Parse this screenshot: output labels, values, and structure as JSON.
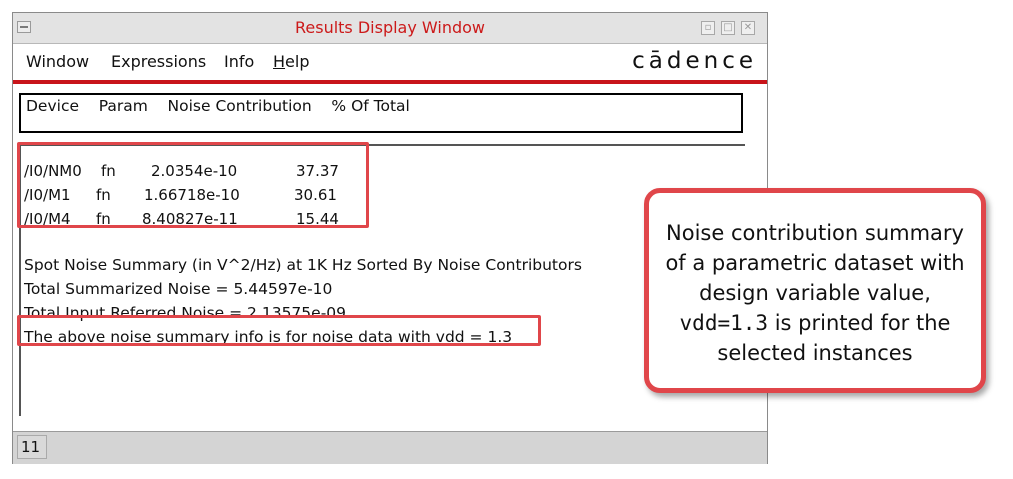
{
  "window": {
    "title": "Results Display Window",
    "controls": [
      "▫",
      "□",
      "✕"
    ]
  },
  "menu": {
    "items": [
      {
        "label": "Window"
      },
      {
        "label": "Expressions"
      },
      {
        "label": "Info"
      },
      {
        "label_first": "H",
        "label_rest": "elp"
      }
    ],
    "brand": "cādence"
  },
  "table": {
    "header": "Device    Param    Noise Contribution    % Of Total",
    "rows": [
      {
        "device": "/I0/NM0",
        "param": "fn",
        "noise": "2.0354e-10",
        "percent": "37.37"
      },
      {
        "device": "/I0/M1",
        "param": "fn",
        "noise": "1.66718e-10",
        "percent": "30.61"
      },
      {
        "device": "/I0/M4",
        "param": "fn",
        "noise": "8.40827e-11",
        "percent": "15.44"
      }
    ]
  },
  "summary": {
    "line1": "Spot Noise Summary (in V^2/Hz) at 1K Hz Sorted By Noise Contributors",
    "line2": "Total Summarized Noise = 5.44597e-10",
    "line3": "Total Input Referred Noise = 2.13575e-09",
    "line4": "The above noise summary info is for noise data with  vdd = 1.3"
  },
  "status": {
    "value": "11"
  },
  "callout": {
    "line1": "Noise contribution summary",
    "line2": "of a parametric dataset with",
    "line3": "design variable value,",
    "code": "vdd=1.3",
    "line4_rest": " is printed for the",
    "line5": "selected instances"
  },
  "colors": {
    "title": "#cc1a1a",
    "accent_line": "#c8141a",
    "highlight": "#e0464a"
  }
}
